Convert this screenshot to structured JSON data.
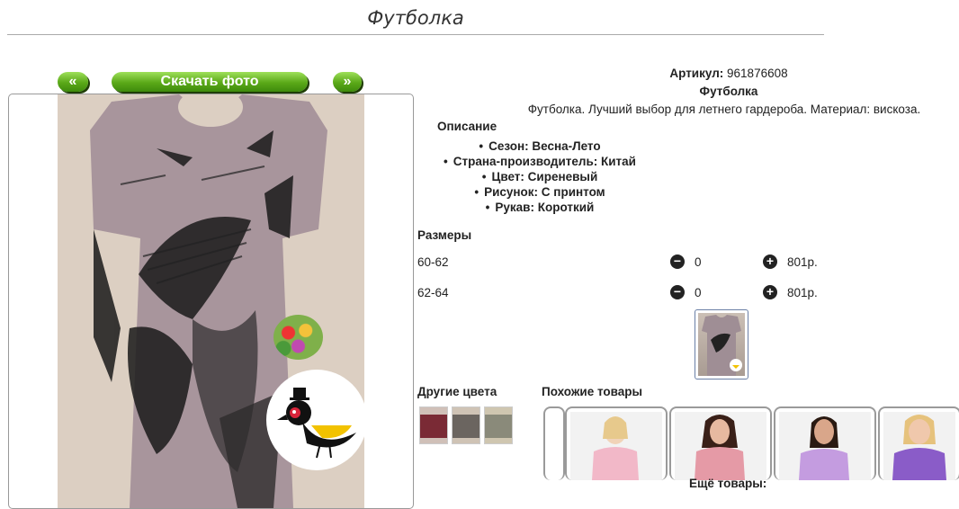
{
  "page": {
    "title": "Футболка"
  },
  "gallery": {
    "prev_label": "«",
    "download_label": "Скачать фото",
    "next_label": "»"
  },
  "product": {
    "article_label": "Артикул:",
    "article_value": "961876608",
    "name": "Футболка",
    "description": "Футболка. Лучший выбор для летнего гардероба. Материал: вискоза.",
    "description_heading": "Описание",
    "attributes": [
      "Сезон: Весна-Лето",
      "Страна-производитель: Китай",
      "Цвет: Сиреневый",
      "Рисунок: С принтом",
      "Рукав: Короткий"
    ]
  },
  "sizes": {
    "heading": "Размеры",
    "minus_symbol": "−",
    "plus_symbol": "+",
    "rows": [
      {
        "size": "60-62",
        "qty": "0",
        "price": "801р."
      },
      {
        "size": "62-64",
        "qty": "0",
        "price": "801р."
      }
    ]
  },
  "other_colors": {
    "heading": "Другие цвета",
    "swatches": [
      "#7a2a35",
      "#6b6560",
      "#8a8a7a"
    ]
  },
  "similar": {
    "heading": "Похожие товары"
  },
  "more": {
    "label": "Ещё товары:"
  },
  "colors": {
    "button_green": "#5aa818",
    "shirt_lilac": "#a8959c",
    "print_black": "#111111",
    "logo_yellow": "#f2c200",
    "logo_red": "#d8243a"
  }
}
